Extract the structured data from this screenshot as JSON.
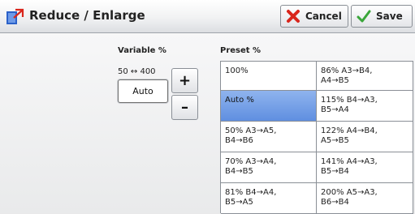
{
  "window": {
    "title": "Reduce / Enlarge",
    "title_icon": "reduce-enlarge-icon"
  },
  "toolbar": {
    "cancel_label": "Cancel",
    "cancel_icon": "red-x-icon",
    "save_label": "Save",
    "save_icon": "green-check-icon"
  },
  "variable": {
    "label": "Variable %",
    "range": "50 ↔ 400",
    "auto_label": "Auto",
    "plus": "+",
    "minus": "–"
  },
  "preset": {
    "label": "Preset %",
    "selected": "Auto %",
    "left": [
      "100%",
      "Auto %",
      "50% A3→A5,\nB4→B6",
      "70% A3→A4,\nB4→B5",
      "81% B4→A4,\nB5→A5"
    ],
    "right": [
      "86% A3→B4,\nA4→B5",
      "115% B4→A3,\nB5→A4",
      "122% A4→B4,\nA5→B5",
      "141% A4→A3,\nB5→B4",
      "200% A5→A3,\nB6→B4"
    ]
  },
  "colors": {
    "selected_cell": "#6f9be6",
    "cancel_icon": "#d9261c",
    "save_icon": "#3aa63a"
  }
}
